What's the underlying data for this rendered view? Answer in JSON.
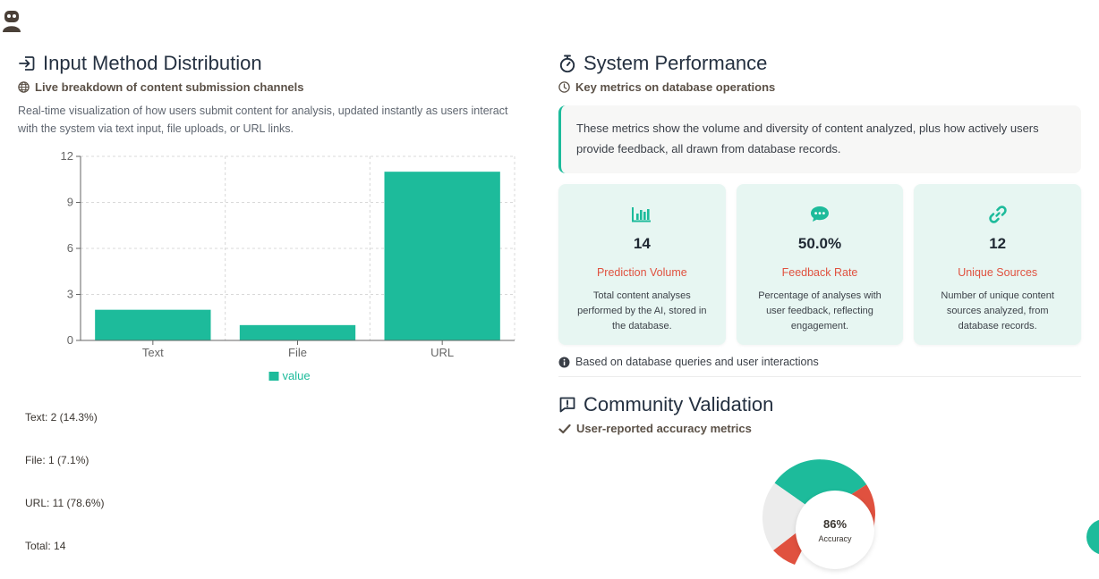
{
  "icons": {
    "avatar": "robot-icon",
    "input_method": "sign-in-icon",
    "globe": "globe-icon",
    "performance": "stopwatch-icon",
    "clock": "clock-icon",
    "info": "info-circle-icon",
    "community": "comment-exclamation-icon",
    "check": "check-icon"
  },
  "colors": {
    "accent": "#1dbb9b",
    "red": "#e0513f",
    "grey": "#ececec"
  },
  "input_method": {
    "title": "Input Method Distribution",
    "subtitle": "Live breakdown of content submission channels",
    "description": "Real-time visualization of how users submit content for analysis, updated instantly as users interact with the system via text input, file uploads, or URL links.",
    "stats": [
      "Text: 2 (14.3%)",
      "File: 1 (7.1%)",
      "URL: 11 (78.6%)",
      "Total: 14"
    ]
  },
  "chart_data": {
    "type": "bar",
    "categories": [
      "Text",
      "File",
      "URL"
    ],
    "series": [
      {
        "name": "value",
        "values": [
          2,
          1,
          11
        ]
      }
    ],
    "ylim": [
      0,
      12
    ],
    "yticks": [
      0,
      3,
      6,
      9,
      12
    ],
    "grid": true,
    "legend": "bottom",
    "color": "#1dbb9b"
  },
  "performance": {
    "title": "System Performance",
    "subtitle": "Key metrics on database operations",
    "info": "These metrics show the volume and diversity of content analyzed, plus how actively users provide feedback, all drawn from database records.",
    "metrics": [
      {
        "icon": "chart-bar-icon",
        "value": "14",
        "name": "Prediction Volume",
        "desc": "Total content analyses performed by the AI, stored in the database."
      },
      {
        "icon": "comment-dots-icon",
        "value": "50.0%",
        "name": "Feedback Rate",
        "desc": "Percentage of analyses with user feedback, reflecting engagement."
      },
      {
        "icon": "link-icon",
        "value": "12",
        "name": "Unique Sources",
        "desc": "Number of unique content sources analyzed, from database records."
      }
    ],
    "note": "Based on database queries and user interactions"
  },
  "community": {
    "title": "Community Validation",
    "subtitle": "User-reported accuracy metrics",
    "accuracy_value": "86%",
    "accuracy_label": "Accuracy"
  }
}
